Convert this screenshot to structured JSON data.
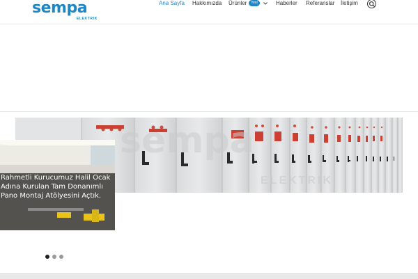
{
  "logo": {
    "text": "sempa",
    "subtext": "ELEKTRIK"
  },
  "nav": {
    "items": [
      {
        "label": "Ana Sayfa",
        "active": true
      },
      {
        "label": "Hakkımızda",
        "active": false
      },
      {
        "label": "Ürünler",
        "active": false,
        "badge": "Yeni"
      },
      {
        "label": "Haberler",
        "active": false
      },
      {
        "label": "Referanslar",
        "active": false
      },
      {
        "label": "İletişim",
        "active": false
      }
    ],
    "icons": {
      "dropdown": "chevron-down-icon",
      "search": "search-icon"
    }
  },
  "slider": {
    "caption": "Rahmetli Kurucumuz Halil Ocak Adına Kurulan Tam Donanımlı Pano Montaj Atölyesini Açtık.",
    "watermark": "sempa",
    "watermark_sub": "ELEKTRIK",
    "dots": 3,
    "active_dot": 0
  },
  "colors": {
    "brand": "#1f86c4",
    "nav_text": "#333333",
    "dot_active": "#222222",
    "dot_inactive": "#999999"
  }
}
